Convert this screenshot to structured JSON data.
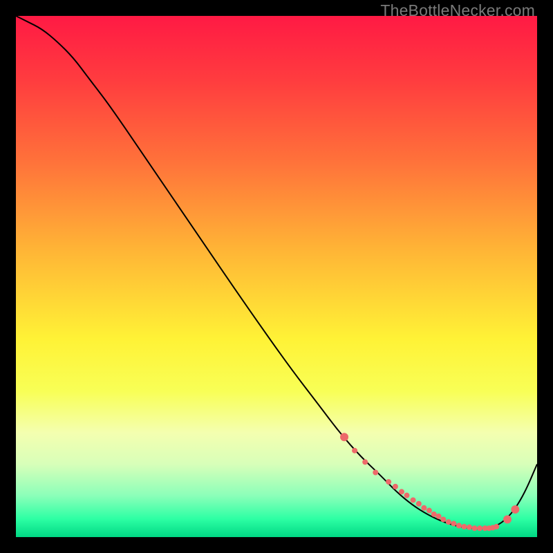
{
  "watermark": "TheBottleNecker.com",
  "chart_data": {
    "type": "line",
    "xlim": [
      0,
      100
    ],
    "ylim": [
      0,
      100
    ],
    "title": "",
    "xlabel": "",
    "ylabel": "",
    "background_gradient": {
      "direction": "vertical",
      "stops": [
        {
          "pos": 0.0,
          "color": "#ff1a44"
        },
        {
          "pos": 0.12,
          "color": "#ff3b3f"
        },
        {
          "pos": 0.28,
          "color": "#ff723a"
        },
        {
          "pos": 0.45,
          "color": "#ffb536"
        },
        {
          "pos": 0.62,
          "color": "#fff236"
        },
        {
          "pos": 0.72,
          "color": "#f8ff56"
        },
        {
          "pos": 0.8,
          "color": "#f4ffb0"
        },
        {
          "pos": 0.86,
          "color": "#d8ffb9"
        },
        {
          "pos": 0.92,
          "color": "#8cffb9"
        },
        {
          "pos": 0.965,
          "color": "#2dffa4"
        },
        {
          "pos": 1.0,
          "color": "#00d884"
        }
      ]
    },
    "curves": [
      {
        "name": "bottleneck-curve",
        "stroke": "#000000",
        "stroke_width": 2,
        "x": [
          0,
          2,
          5,
          8,
          11,
          14,
          18,
          24,
          30,
          36,
          42,
          48,
          53,
          58,
          62,
          66,
          70,
          73,
          76,
          79,
          82,
          85,
          88,
          90,
          92.5,
          95,
          97.5,
          100
        ],
        "values": [
          100,
          99,
          97.5,
          95,
          92,
          88,
          82.8,
          74,
          65.2,
          56.4,
          47.6,
          39,
          32,
          25.5,
          20.2,
          15.6,
          11.8,
          8.7,
          6.2,
          4.3,
          2.9,
          2.0,
          1.6,
          1.6,
          2.2,
          4.3,
          8.2,
          14
        ]
      }
    ],
    "marker_series": {
      "name": "curve-dots",
      "color": "#ed6a6a",
      "radius_small": 4,
      "radius_large": 6,
      "x": [
        63,
        65,
        67,
        69,
        71.5,
        72.8,
        74,
        75,
        76.2,
        77.3,
        78.3,
        79.3,
        80.2,
        81.1,
        82,
        83,
        84,
        85,
        86,
        87,
        88,
        89,
        90,
        90.8,
        91.5,
        92.2,
        94.3,
        95.8
      ],
      "values": [
        19.2,
        16.6,
        14.4,
        12.4,
        10.6,
        9.7,
        8.7,
        8.0,
        7.1,
        6.4,
        5.6,
        5.1,
        4.4,
        4.0,
        3.4,
        2.9,
        2.6,
        2.2,
        2.0,
        1.9,
        1.7,
        1.7,
        1.7,
        1.7,
        1.8,
        2.0,
        3.4,
        5.3
      ],
      "large_indices": [
        0,
        26,
        27
      ]
    }
  }
}
